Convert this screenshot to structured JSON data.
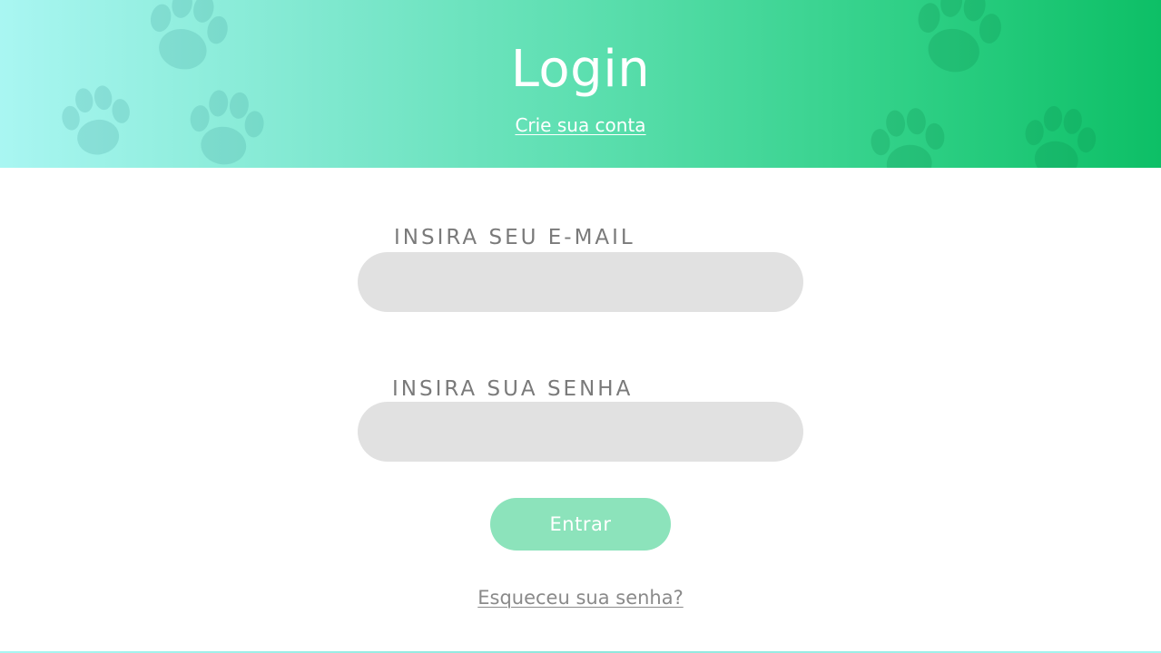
{
  "header": {
    "title": "Login",
    "create_account_link": "Crie sua conta",
    "background_icon": "paw-print-icon",
    "gradient_start": "#a9f6f2",
    "gradient_end": "#0dbf66"
  },
  "form": {
    "email_label": "INSIRA SEU E-MAIL",
    "email_value": "",
    "password_label": "INSIRA SUA SENHA",
    "password_value": "",
    "submit_label": "Entrar",
    "forgot_password_link": "Esqueceu sua senha?"
  },
  "colors": {
    "input_background": "#e1e1e1",
    "button_background": "#8ce3bb",
    "label_text": "#7a7a7a"
  }
}
